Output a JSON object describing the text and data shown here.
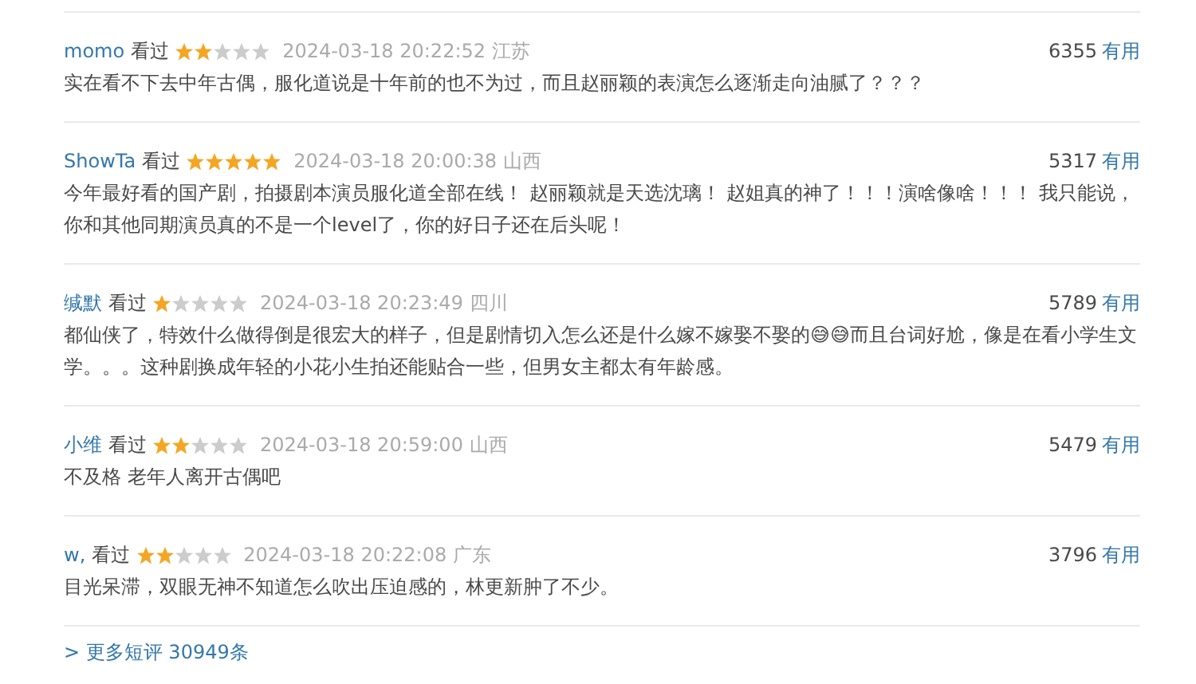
{
  "reviews": [
    {
      "user": "momo",
      "status": "看过",
      "stars": 2,
      "time": "2024-03-18 20:22:52",
      "location": "江苏",
      "votes": "6355",
      "vote_label": "有用",
      "text": "实在看不下去中年古偶，服化道说是十年前的也不为过，而且赵丽颖的表演怎么逐渐走向油腻了？？？"
    },
    {
      "user": "ShowTa",
      "status": "看过",
      "stars": 5,
      "time": "2024-03-18 20:00:38",
      "location": "山西",
      "votes": "5317",
      "vote_label": "有用",
      "text": "今年最好看的国产剧，拍摄剧本演员服化道全部在线！ 赵丽颖就是天选沈璃！ 赵姐真的神了！！！演啥像啥！！！ 我只能说，你和其他同期演员真的不是一个level了，你的好日子还在后头呢！"
    },
    {
      "user": "缄默",
      "status": "看过",
      "stars": 1,
      "time": "2024-03-18 20:23:49",
      "location": "四川",
      "votes": "5789",
      "vote_label": "有用",
      "text": "都仙侠了，特效什么做得倒是很宏大的样子，但是剧情切入怎么还是什么嫁不嫁娶不娶的😅😅而且台词好尬，像是在看小学生文学。。。这种剧换成年轻的小花小生拍还能贴合一些，但男女主都太有年龄感。"
    },
    {
      "user": "小维",
      "status": "看过",
      "stars": 2,
      "time": "2024-03-18 20:59:00",
      "location": "山西",
      "votes": "5479",
      "vote_label": "有用",
      "text": "不及格 老年人离开古偶吧"
    },
    {
      "user": "w,",
      "status": "看过",
      "stars": 2,
      "time": "2024-03-18 20:22:08",
      "location": "广东",
      "votes": "3796",
      "vote_label": "有用",
      "text": "目光呆滞，双眼无神不知道怎么吹出压迫感的，林更新肿了不少。"
    }
  ],
  "more_link": "> 更多短评 30949条"
}
